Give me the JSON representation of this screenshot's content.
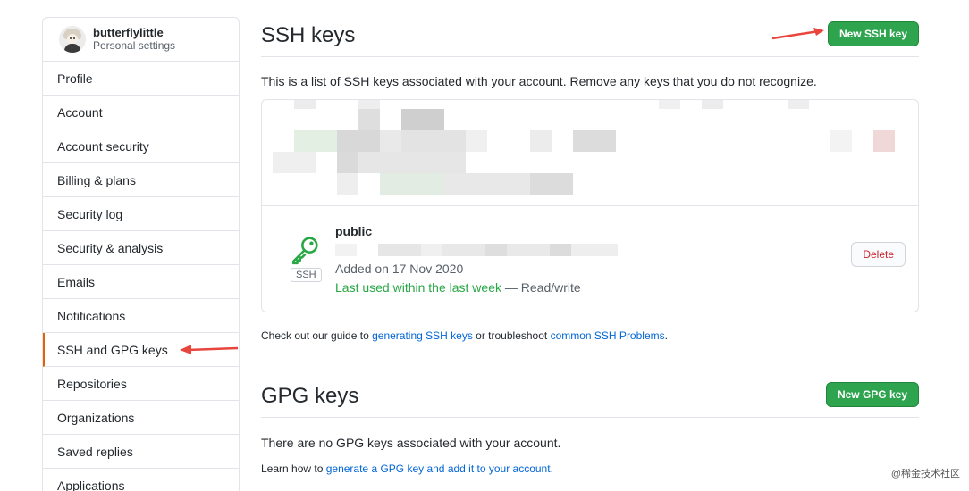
{
  "sidebar": {
    "username": "butterflylittle",
    "subtitle": "Personal settings",
    "items": [
      {
        "label": "Profile"
      },
      {
        "label": "Account"
      },
      {
        "label": "Account security"
      },
      {
        "label": "Billing & plans"
      },
      {
        "label": "Security log"
      },
      {
        "label": "Security & analysis"
      },
      {
        "label": "Emails"
      },
      {
        "label": "Notifications"
      },
      {
        "label": "SSH and GPG keys",
        "selected": true
      },
      {
        "label": "Repositories"
      },
      {
        "label": "Organizations"
      },
      {
        "label": "Saved replies"
      },
      {
        "label": "Applications"
      }
    ]
  },
  "ssh": {
    "title": "SSH keys",
    "new_button": "New SSH key",
    "description": "This is a list of SSH keys associated with your account. Remove any keys that you do not recognize.",
    "key": {
      "title": "public",
      "type_label": "SSH",
      "added": "Added on 17 Nov 2020",
      "last_used": "Last used within the last week",
      "access": "— Read/write",
      "delete_button": "Delete"
    },
    "guide": {
      "prefix": "Check out our guide to",
      "link1": "generating SSH keys",
      "middle": "or troubleshoot",
      "link2": "common SSH Problems",
      "suffix": "."
    }
  },
  "gpg": {
    "title": "GPG keys",
    "new_button": "New GPG key",
    "description": "There are no GPG keys associated with your account.",
    "learn": {
      "prefix": "Learn how to",
      "link": "generate a GPG key and add it to your account",
      "suffix": "."
    }
  },
  "watermark": "@稀金技术社区",
  "colors": {
    "accent_green": "#2ea44f",
    "link_blue": "#0366d6",
    "danger_red": "#cb2431",
    "annotation_arrow": "#e8453c",
    "selected_border": "#e36209"
  }
}
